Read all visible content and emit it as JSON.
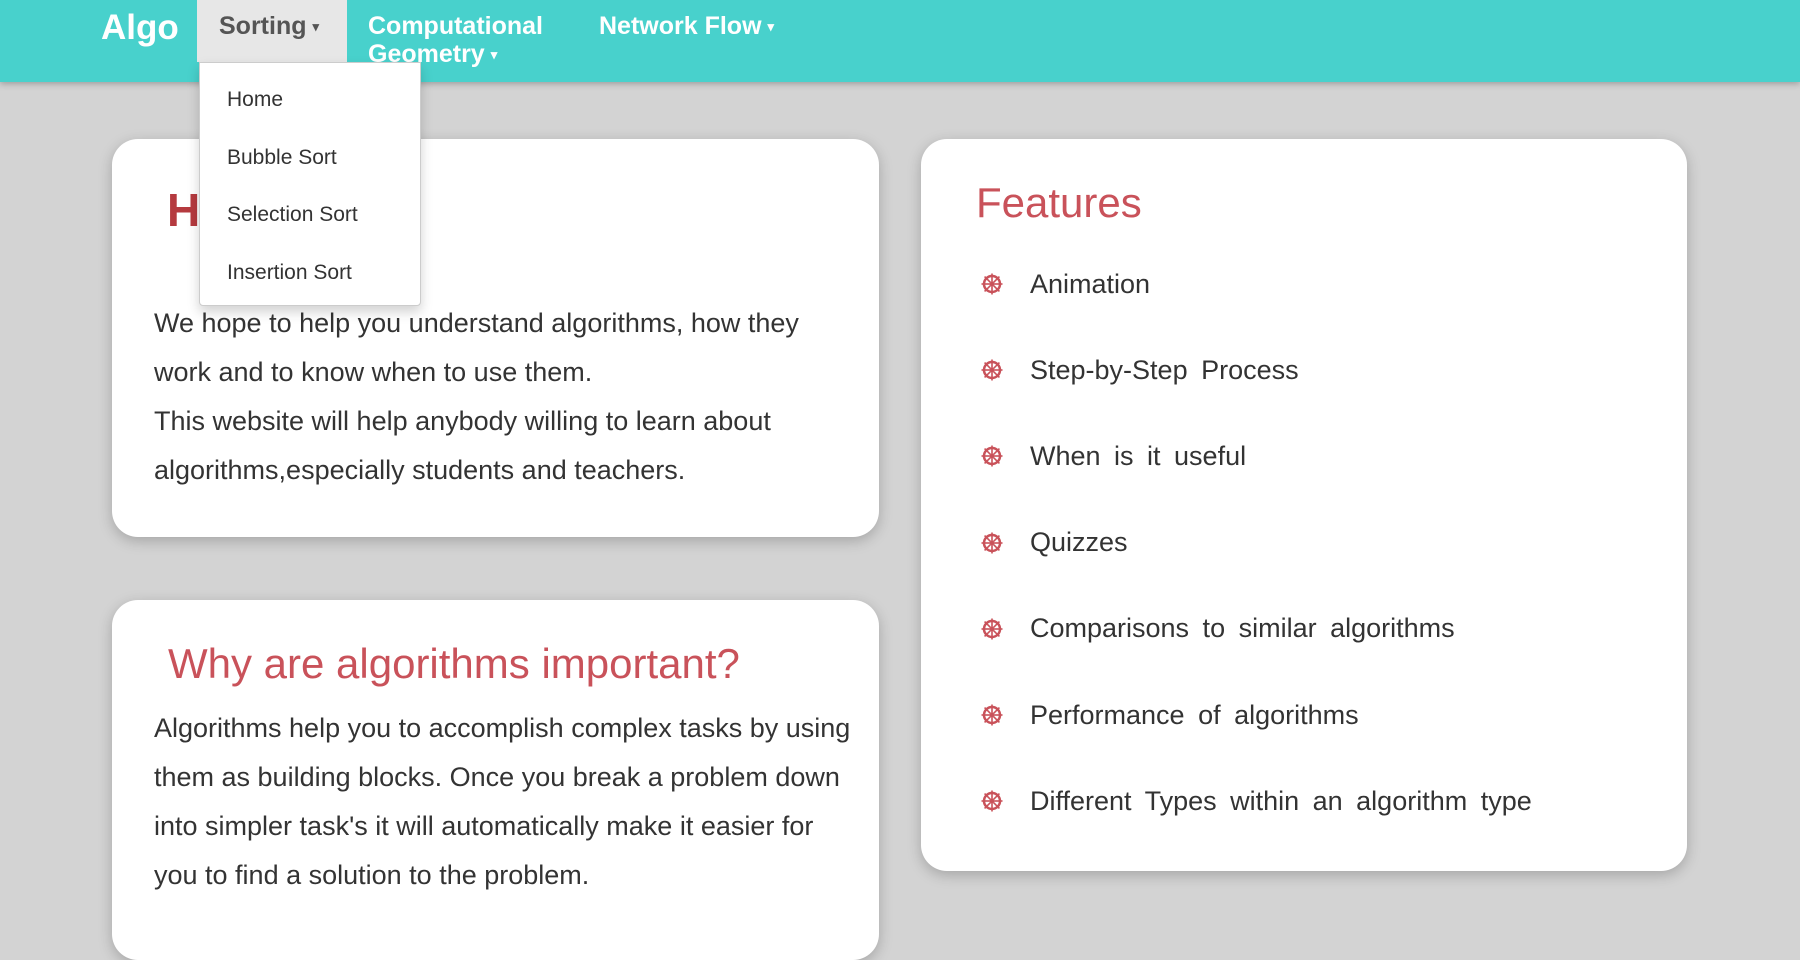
{
  "navbar": {
    "brand": "Algo",
    "items": [
      {
        "label": "Sorting"
      },
      {
        "label": "Computational Geometry"
      },
      {
        "label": "Network Flow"
      }
    ],
    "caret": "▾",
    "sorting_dropdown": [
      "Home",
      "Bubble Sort",
      "Selection Sort",
      "Insertion Sort"
    ]
  },
  "hello_card": {
    "title": "H",
    "paragraph1": "We hope to help you understand algorithms, how they work and to know when to use them.",
    "paragraph2": "This website will help anybody willing to learn about algorithms,especially students and teachers."
  },
  "why_card": {
    "title": "Why are algorithms important?",
    "paragraph": "Algorithms help you to accomplish complex tasks by using them as building blocks. Once you break a problem down into simpler task's it will automatically make it easier for you to find a solution to the problem."
  },
  "features_card": {
    "title": "Features",
    "icon": "ship-wheel-icon",
    "items": [
      "Animation",
      "Step-by-Step Process",
      "When is it useful",
      "Quizzes",
      "Comparisons to similar algorithms",
      "Performance of algorithms",
      "Different Types within an algorithm type"
    ]
  },
  "colors": {
    "navbar": "#48d1cc",
    "background": "#d3d3d3",
    "accent": "#c9525a"
  }
}
